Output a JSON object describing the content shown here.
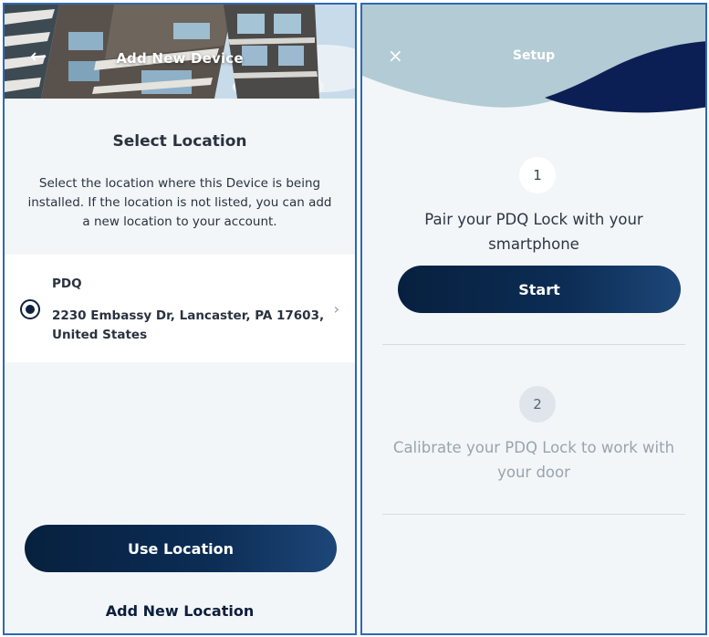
{
  "left_screen": {
    "header": {
      "title": "Add New Device",
      "back_icon": "back-arrow-icon",
      "back_glyph": "←"
    },
    "section": {
      "title": "Select Location",
      "description": "Select the location where this Device is being installed. If the location is not listed, you can add a new location to your account."
    },
    "location": {
      "name": "PDQ",
      "address": "2230 Embassy Dr, Lancaster, PA 17603, United States",
      "selected": true,
      "chevron_glyph": "›"
    },
    "use_location_label": "Use Location",
    "add_new_location_label": "Add New Location"
  },
  "right_screen": {
    "header": {
      "title": "Setup",
      "close_glyph": "×"
    },
    "steps": [
      {
        "number": "1",
        "text": "Pair your PDQ Lock with your smartphone",
        "active": true
      },
      {
        "number": "2",
        "text": "Calibrate your PDQ Lock to work with your door",
        "active": false
      }
    ],
    "start_label": "Start"
  },
  "colors": {
    "navy": "#0c2d55",
    "panel_border": "#2f68b3",
    "background": "#f2f6f8",
    "wave_light": "#b3cbd4",
    "wave_dark": "#0c1f55"
  }
}
